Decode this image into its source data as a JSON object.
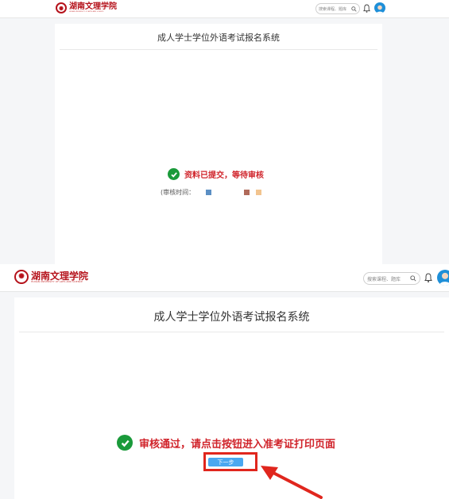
{
  "school_name": "湖南文理学院",
  "school_subtitle": "HUNAN UNIVERSITY OF ARTS AND SCIENCE",
  "search_placeholder": "搜索课程、题库",
  "system_title": "成人学士学位外语考试报名系统",
  "screen1": {
    "status_text": "资料已提交，等待审核",
    "review_time_label": "(审核时间：",
    "status_color": "#d0232a"
  },
  "screen2": {
    "status_text": "审核通过，请点击按钮进入准考证打印页面",
    "next_button_label": "下一步",
    "status_color": "#d0232a",
    "highlight_color": "#e0261d"
  },
  "icons": [
    "seal-logo-icon",
    "search-icon",
    "bell-icon",
    "avatar",
    "check-circle-icon",
    "red-arrow"
  ]
}
